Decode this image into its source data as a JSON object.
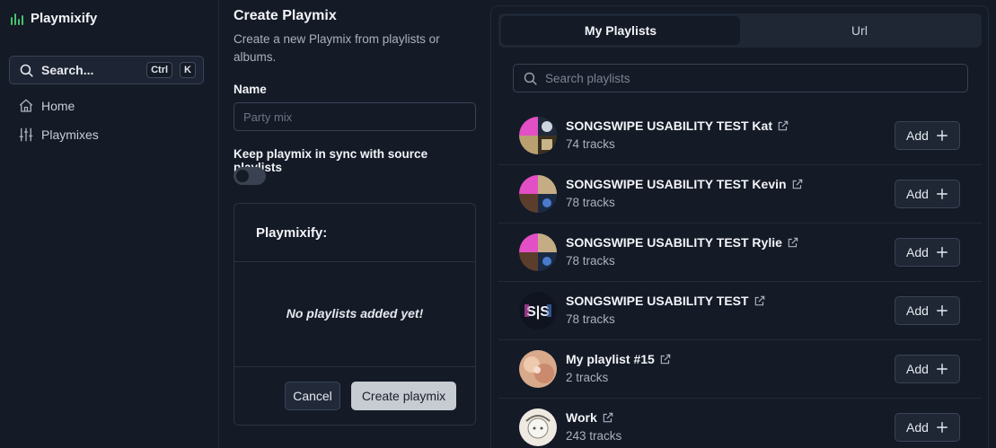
{
  "app": {
    "title": "Playmixify",
    "brand_color": "#46c36e"
  },
  "sidebar": {
    "search": {
      "label": "Search...",
      "shortcut_mod": "Ctrl",
      "shortcut_key": "K"
    },
    "items": [
      {
        "label": "Home",
        "icon": "home-icon"
      },
      {
        "label": "Playmixes",
        "icon": "sliders-icon"
      }
    ]
  },
  "create": {
    "title": "Create Playmix",
    "subtitle": "Create a new Playmix from playlists or albums.",
    "name_label": "Name",
    "name_placeholder": "Party mix",
    "name_value": "",
    "sync_label": "Keep playmix in sync with source playlists",
    "sync_on": false,
    "card_title": "Playmixify:",
    "empty_text": "No playlists added yet!",
    "cancel_label": "Cancel",
    "create_label": "Create playmix"
  },
  "right": {
    "tabs": [
      {
        "label": "My Playlists",
        "active": true
      },
      {
        "label": "Url",
        "active": false
      }
    ],
    "search_placeholder": "Search playlists",
    "add_label": "Add",
    "playlists": [
      {
        "name": "SONGSWIPE USABILITY TEST Kat",
        "tracks": "74 tracks",
        "art": "collage"
      },
      {
        "name": "SONGSWIPE USABILITY TEST Kevin",
        "tracks": "78 tracks",
        "art": "collage"
      },
      {
        "name": "SONGSWIPE USABILITY TEST Rylie",
        "tracks": "78 tracks",
        "art": "collage"
      },
      {
        "name": "SONGSWIPE USABILITY TEST",
        "tracks": "78 tracks",
        "art": "logo"
      },
      {
        "name": "My playlist #15",
        "tracks": "2 tracks",
        "art": "peach"
      },
      {
        "name": "Work",
        "tracks": "243 tracks",
        "art": "sketch"
      }
    ]
  }
}
